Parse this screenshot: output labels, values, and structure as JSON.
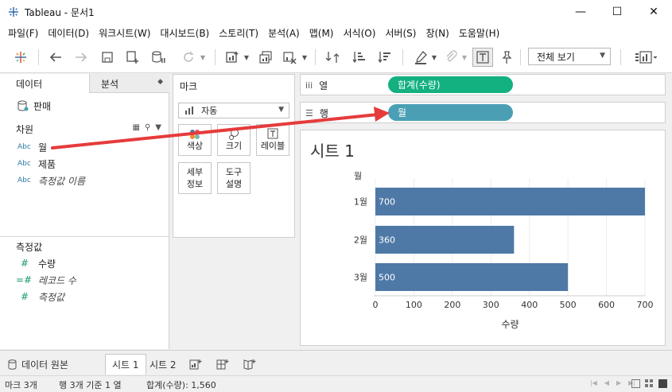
{
  "window": {
    "title": "Tableau - 문서1",
    "minimize": "—",
    "maximize": "☐",
    "close": "✕"
  },
  "menu": [
    "파일(F)",
    "데이터(D)",
    "워크시트(W)",
    "대시보드(B)",
    "스토리(T)",
    "분석(A)",
    "맵(M)",
    "서식(O)",
    "서버(S)",
    "창(N)",
    "도움말(H)"
  ],
  "toolbar": {
    "view_select": "전체 보기",
    "icons": [
      "tableau-logo-icon",
      "back-icon",
      "forward-icon",
      "save-icon",
      "new-datasource-icon",
      "pause-update-icon",
      "refresh-icon",
      "new-worksheet-icon",
      "duplicate-icon",
      "clear-sheet-icon",
      "swap-axes-icon",
      "sort-ascending-icon",
      "sort-descending-icon",
      "highlight-icon",
      "group-icon",
      "label-toggle-icon",
      "pin-icon",
      "show-me-icon"
    ]
  },
  "left_panel": {
    "tab_data": "데이터",
    "tab_analysis": "분석",
    "datasource": "판매",
    "dimensions_title": "차원",
    "dimensions": [
      {
        "type": "Abc",
        "label": "월",
        "italic": false
      },
      {
        "type": "Abc",
        "label": "제품",
        "italic": false
      },
      {
        "type": "Abc",
        "label": "측정값 이름",
        "italic": true
      }
    ],
    "measures_title": "측정값",
    "measures": [
      {
        "type": "#",
        "label": "수량",
        "italic": false
      },
      {
        "type": "=#",
        "label": "레코드 수",
        "italic": true
      },
      {
        "type": "#",
        "label": "측정값",
        "italic": true
      }
    ]
  },
  "marks": {
    "title": "마크",
    "type": "자동",
    "color": "색상",
    "size": "크기",
    "label": "레이블",
    "detail_line1": "세부",
    "detail_line2": "정보",
    "tooltip_line1": "도구",
    "tooltip_line2": "설명"
  },
  "shelves": {
    "columns_label": "열",
    "columns_pill": "합계(수량)",
    "rows_label": "행",
    "rows_pill": "월"
  },
  "chart_data": {
    "type": "bar",
    "orientation": "horizontal",
    "title": "시트 1",
    "row_header": "월",
    "categories": [
      "1월",
      "2월",
      "3월"
    ],
    "values": [
      700,
      360,
      500
    ],
    "data_labels": [
      "700",
      "360",
      "500"
    ],
    "xlabel": "수량",
    "xlim": [
      0,
      700
    ],
    "xticks": [
      "0",
      "100",
      "200",
      "300",
      "400",
      "500",
      "600",
      "700"
    ],
    "bar_color": "#4e79a7",
    "grid": true
  },
  "bottom_tabs": {
    "datasource": "데이터 원본",
    "sheets": [
      "시트 1",
      "시트 2"
    ],
    "active_sheet": "시트 1"
  },
  "status": {
    "marks": "마크 3개",
    "rows_cols": "행 3개 기준 1 열",
    "sum": "합계(수량): 1,560"
  },
  "colors": {
    "green_pill": "#13b080",
    "blue_pill": "#4b9fb5",
    "bar": "#4e79a7",
    "annotation_arrow": "#e63b3b"
  }
}
